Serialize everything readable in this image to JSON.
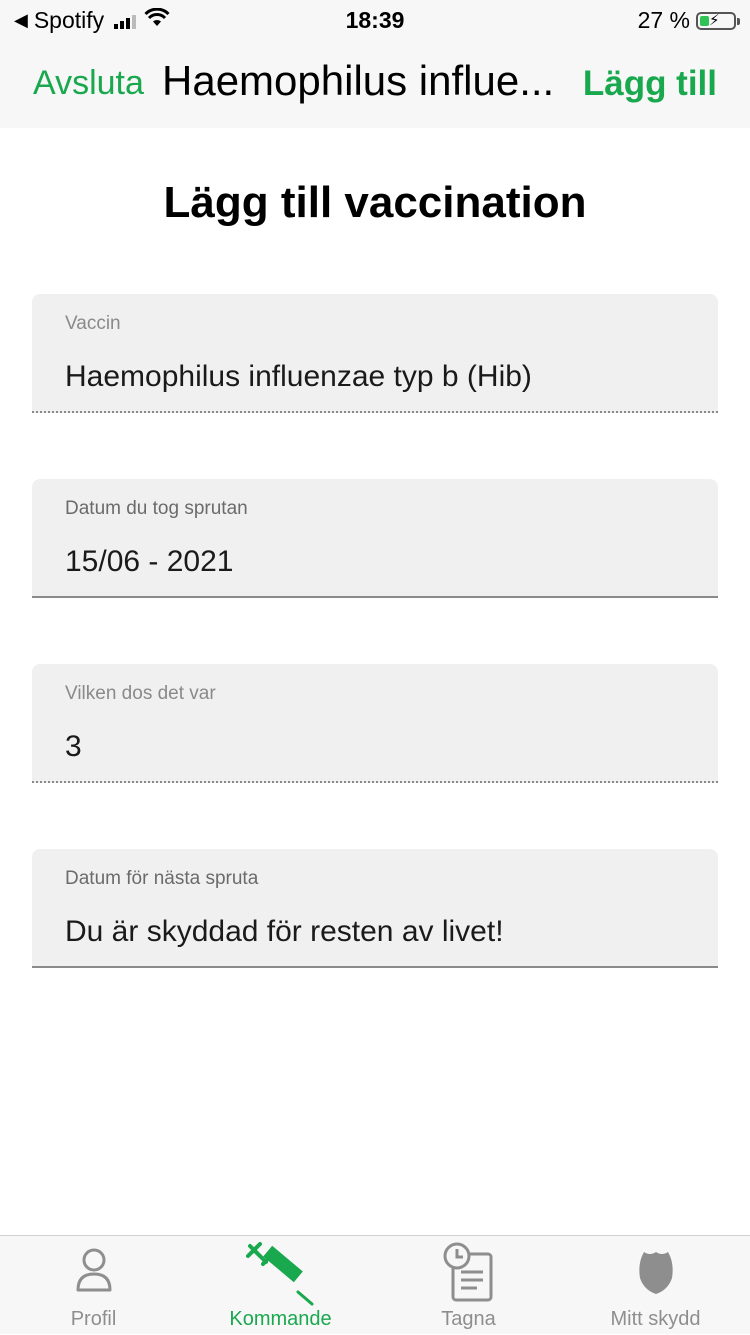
{
  "status_bar": {
    "back_app": "Spotify",
    "time": "18:39",
    "battery_percent_text": "27 %",
    "battery_level": 0.27
  },
  "nav": {
    "cancel_label": "Avsluta",
    "title": "Haemophilus influe...",
    "add_label": "Lägg till"
  },
  "page": {
    "title": "Lägg till vaccination"
  },
  "fields": [
    {
      "label": "Vaccin",
      "value": "Haemophilus influenzae typ b (Hib)"
    },
    {
      "label": "Datum du tog sprutan",
      "value": "15/06 - 2021"
    },
    {
      "label": "Vilken dos det var",
      "value": "3"
    },
    {
      "label": "Datum för nästa spruta",
      "value": "Du är skyddad för resten av livet!"
    }
  ],
  "tabs": [
    {
      "label": "Profil",
      "icon": "person-icon",
      "active": false
    },
    {
      "label": "Kommande",
      "icon": "syringe-icon",
      "active": true
    },
    {
      "label": "Tagna",
      "icon": "clock-document-icon",
      "active": false
    },
    {
      "label": "Mitt skydd",
      "icon": "shield-icon",
      "active": false
    }
  ],
  "colors": {
    "accent": "#1aa84f",
    "inactive_tab": "#8e8e8e",
    "field_bg": "#f0f0f0"
  }
}
